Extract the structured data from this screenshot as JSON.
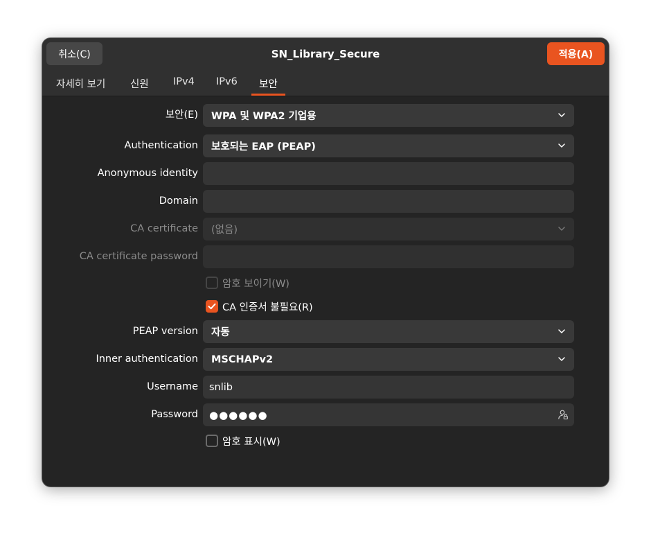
{
  "header": {
    "cancel_label": "취소(C)",
    "title": "SN_Library_Secure",
    "apply_label": "적용(A)"
  },
  "tabs": [
    {
      "label": "자세히 보기"
    },
    {
      "label": "신원"
    },
    {
      "label": "IPv4"
    },
    {
      "label": "IPv6"
    },
    {
      "label": "보안",
      "active": true
    }
  ],
  "form": {
    "security": {
      "label": "보안(E)",
      "value": "WPA 및 WPA2 기업용"
    },
    "authentication": {
      "label": "Authentication",
      "value": "보호되는 EAP (PEAP)"
    },
    "anonymous_identity": {
      "label": "Anonymous identity",
      "value": ""
    },
    "domain": {
      "label": "Domain",
      "value": ""
    },
    "ca_certificate": {
      "label": "CA certificate",
      "value": "(없음)"
    },
    "ca_certificate_password": {
      "label": "CA certificate password",
      "value": ""
    },
    "show_passwords_ca": {
      "label": "암호 보이기(W)",
      "checked": false
    },
    "no_ca_required": {
      "label": "CA 인증서 불필요(R)",
      "checked": true
    },
    "peap_version": {
      "label": "PEAP version",
      "value": "자동"
    },
    "inner_authentication": {
      "label": "Inner authentication",
      "value": "MSCHAPv2"
    },
    "username": {
      "label": "Username",
      "value": "snlib"
    },
    "password": {
      "label": "Password",
      "value": "●●●●●●"
    },
    "show_password": {
      "label": "암호 표시(W)",
      "checked": false
    }
  },
  "colors": {
    "accent": "#e95420",
    "window_bg": "#242424",
    "header_bg": "#303030",
    "field_bg": "#393939"
  },
  "icons": {
    "dropdown": "chevron-down-icon",
    "check": "check-icon",
    "password_reveal": "user-lock-icon"
  }
}
